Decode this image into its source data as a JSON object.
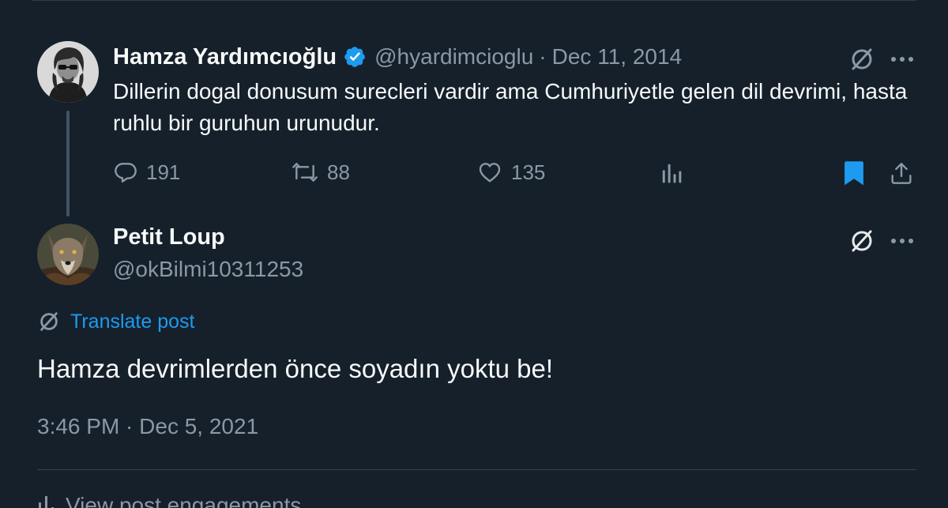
{
  "original_post": {
    "author_name": "Hamza Yardımcıoğlu",
    "handle": "@hyardimcioglu",
    "separator": "·",
    "date": "Dec 11, 2014",
    "text": "Dillerin dogal donusum surecleri vardir ama Cumhuriyetle gelen dil devrimi, hasta ruhlu bir guruhun urunudur.",
    "verified": true,
    "actions": {
      "replies": "191",
      "reposts": "88",
      "likes": "135"
    },
    "bookmarked": true
  },
  "reply_post": {
    "author_name": "Petit Loup",
    "handle": "@okBilmi10311253",
    "translate_label": "Translate post",
    "text": "Hamza devrimlerden önce soyadın yoktu be!",
    "timestamp": "3:46 PM · Dec 5, 2021"
  },
  "engagement_label": "View post engagements",
  "colors": {
    "background": "#15202b",
    "text_primary": "#f7f9f9",
    "text_secondary": "#8b98a5",
    "accent": "#1d9bf0"
  },
  "icons": [
    "verified-badge-icon",
    "grok-icon",
    "more-icon",
    "reply-icon",
    "repost-icon",
    "like-icon",
    "views-icon",
    "bookmark-icon",
    "share-icon",
    "translate-icon",
    "engagements-icon"
  ]
}
